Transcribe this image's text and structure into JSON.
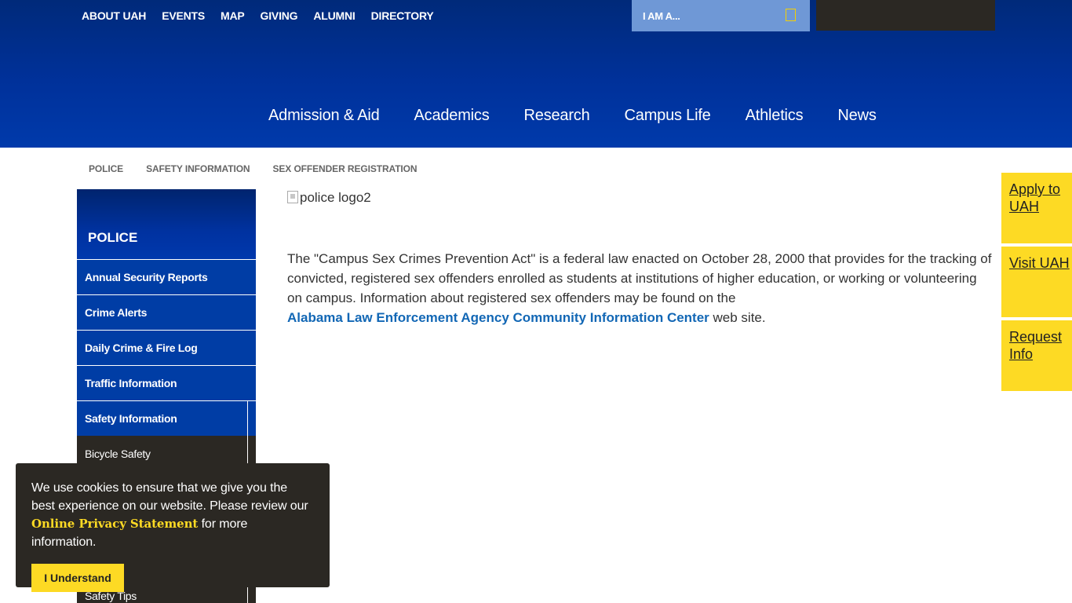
{
  "utility_nav": [
    "ABOUT UAH",
    "EVENTS",
    "MAP",
    "GIVING",
    "ALUMNI",
    "DIRECTORY"
  ],
  "iam": {
    "label": "I AM A..."
  },
  "main_nav": [
    "Admission & Aid",
    "Academics",
    "Research",
    "Campus Life",
    "Athletics",
    "News"
  ],
  "breadcrumb": [
    "POLICE",
    "SAFETY INFORMATION",
    "SEX OFFENDER REGISTRATION"
  ],
  "sidebar": {
    "title": "POLICE",
    "items": [
      "Annual Security Reports",
      "Crime Alerts",
      "Daily Crime & Fire Log",
      "Traffic Information",
      "Safety Information"
    ],
    "subitems": [
      "Bicycle Safety",
      "Safety Tips"
    ]
  },
  "content": {
    "image_alt": "police logo2",
    "paragraph": "The \"Campus Sex Crimes Prevention Act\" is a federal law enacted on October 28, 2000 that provides for the tracking of convicted, registered sex offenders enrolled as students at institutions of higher education, or working or volunteering on campus. Information about registered sex offenders may be found on the",
    "link_text": "Alabama Law Enforcement Agency Community Information Center",
    "after_link": " web site."
  },
  "cta": [
    "Apply to UAH",
    "Visit UAH",
    "Request Info"
  ],
  "cookie": {
    "text_before": "We use cookies to ensure that we give you the best experience on our website. Please review our ",
    "link": "Online Privacy Statement",
    "text_after": " for more information.",
    "button": "I Understand"
  },
  "colors": {
    "brand_blue": "#003da5",
    "accent_yellow": "#fdda24",
    "dark": "#2b2823",
    "link_blue": "#1267b5"
  }
}
